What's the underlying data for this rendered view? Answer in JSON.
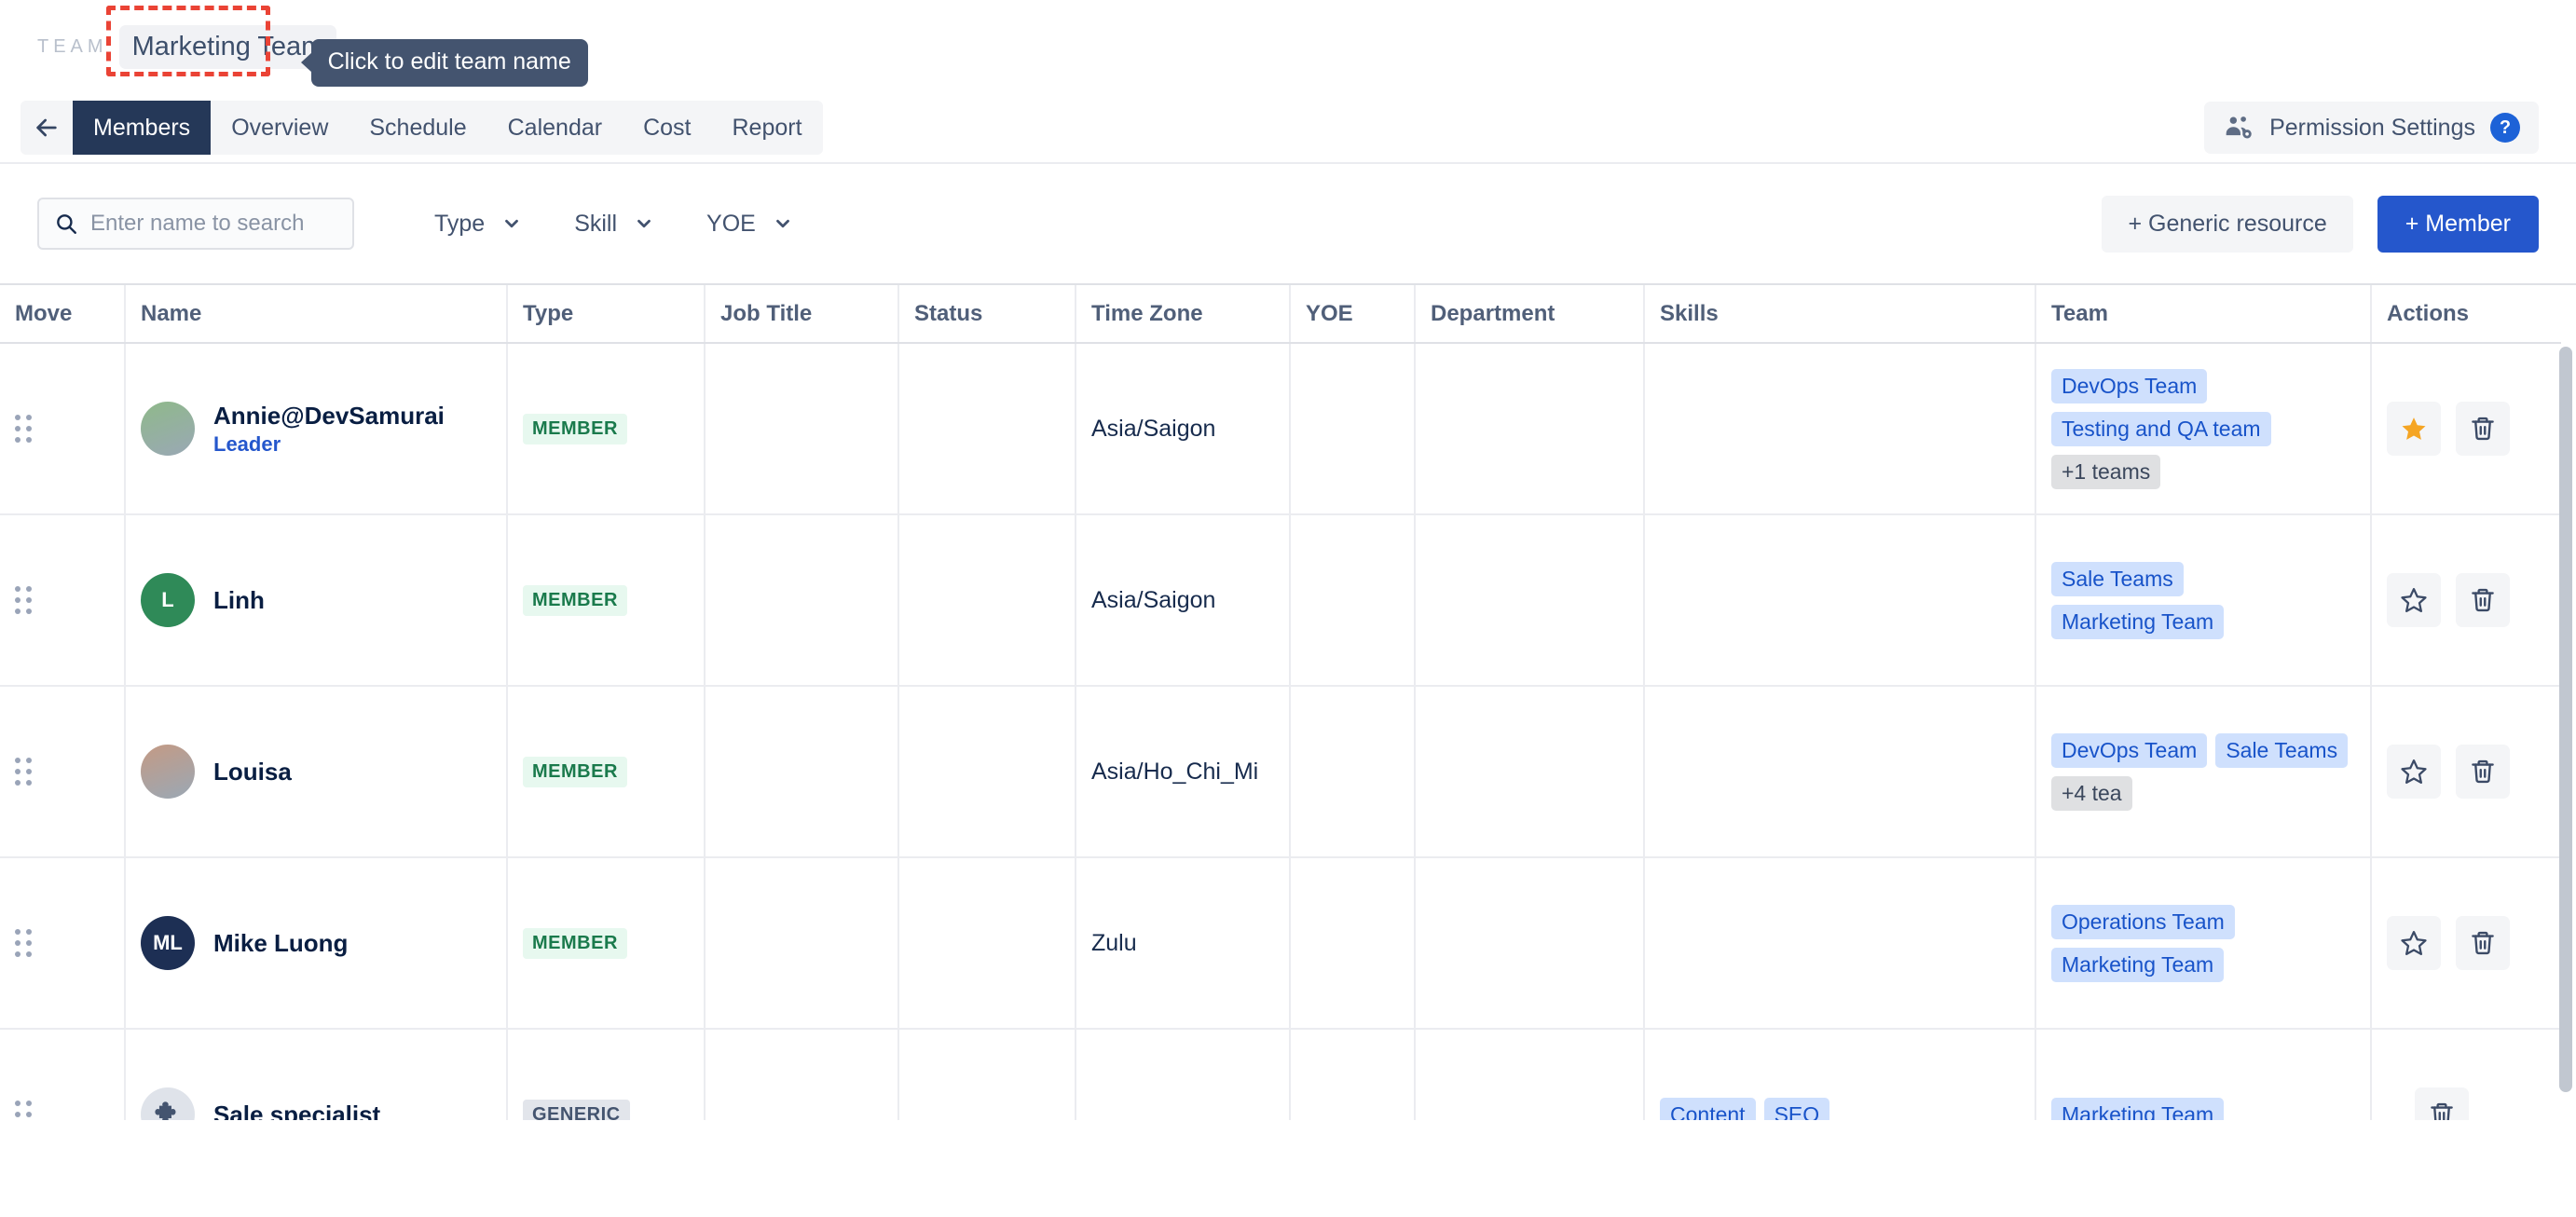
{
  "header": {
    "team_label": "TEAM",
    "team_name": "Marketing Team",
    "tooltip": "Click to edit team name",
    "back_icon": "arrow-left-icon",
    "tabs": [
      {
        "label": "Members",
        "active": true
      },
      {
        "label": "Overview",
        "active": false
      },
      {
        "label": "Schedule",
        "active": false
      },
      {
        "label": "Calendar",
        "active": false
      },
      {
        "label": "Cost",
        "active": false
      },
      {
        "label": "Report",
        "active": false
      }
    ],
    "permission_settings": "Permission Settings",
    "permission_icon": "people-gear-icon",
    "help_badge": "?"
  },
  "toolbar": {
    "search_placeholder": "Enter name to search",
    "search_value": "",
    "search_icon": "search-icon",
    "filters": [
      {
        "label": "Type"
      },
      {
        "label": "Skill"
      },
      {
        "label": "YOE"
      }
    ],
    "generic_resource_button": "+ Generic resource",
    "member_button": "+ Member",
    "member_button_color": "#2557cc"
  },
  "table": {
    "columns": [
      "Move",
      "Name",
      "Type",
      "Job Title",
      "Status",
      "Time Zone",
      "YOE",
      "Department",
      "Skills",
      "Team",
      "Actions"
    ],
    "rows": [
      {
        "name": "Annie@DevSamurai",
        "role": "Leader",
        "avatar_type": "photo",
        "avatar_initials": "",
        "avatar_color": "#8fb98a",
        "type": "MEMBER",
        "type_style": "member",
        "job_title": "",
        "status": "",
        "time_zone": "Asia/Saigon",
        "yoe": "",
        "department": "",
        "skills": [],
        "teams": [
          "DevOps Team",
          "Testing and QA team"
        ],
        "teams_more": "+1 teams",
        "star": "filled",
        "has_star": true,
        "has_delete": true
      },
      {
        "name": "Linh",
        "role": "",
        "avatar_type": "initial",
        "avatar_initials": "L",
        "avatar_color": "#2f8a58",
        "type": "MEMBER",
        "type_style": "member",
        "job_title": "",
        "status": "",
        "time_zone": "Asia/Saigon",
        "yoe": "",
        "department": "",
        "skills": [],
        "teams": [
          "Sale Teams",
          "Marketing Team"
        ],
        "teams_more": "",
        "star": "outline",
        "has_star": true,
        "has_delete": true
      },
      {
        "name": "Louisa",
        "role": "",
        "avatar_type": "photo",
        "avatar_initials": "",
        "avatar_color": "#c49a84",
        "type": "MEMBER",
        "type_style": "member",
        "job_title": "",
        "status": "",
        "time_zone": "Asia/Ho_Chi_Mi",
        "yoe": "",
        "department": "",
        "skills": [],
        "teams": [
          "DevOps Team",
          "Sale Teams"
        ],
        "teams_more": "+4 tea",
        "star": "outline",
        "has_star": true,
        "has_delete": true
      },
      {
        "name": "Mike Luong",
        "role": "",
        "avatar_type": "initial",
        "avatar_initials": "ML",
        "avatar_color": "#1d2f54",
        "type": "MEMBER",
        "type_style": "member",
        "job_title": "",
        "status": "",
        "time_zone": "Zulu",
        "yoe": "",
        "department": "",
        "skills": [],
        "teams": [
          "Operations Team",
          "Marketing Team"
        ],
        "teams_more": "",
        "star": "outline",
        "has_star": true,
        "has_delete": true
      },
      {
        "name": "Sale specialist",
        "role": "",
        "avatar_type": "puzzle",
        "avatar_initials": "",
        "avatar_color": "#dfe3ea",
        "type": "GENERIC",
        "type_style": "generic",
        "job_title": "",
        "status": "",
        "time_zone": "",
        "yoe": "",
        "department": "",
        "skills": [
          "Content",
          "SEO"
        ],
        "teams": [
          "Marketing Team"
        ],
        "teams_more": "",
        "star": "none",
        "has_star": false,
        "has_delete": true
      }
    ]
  }
}
